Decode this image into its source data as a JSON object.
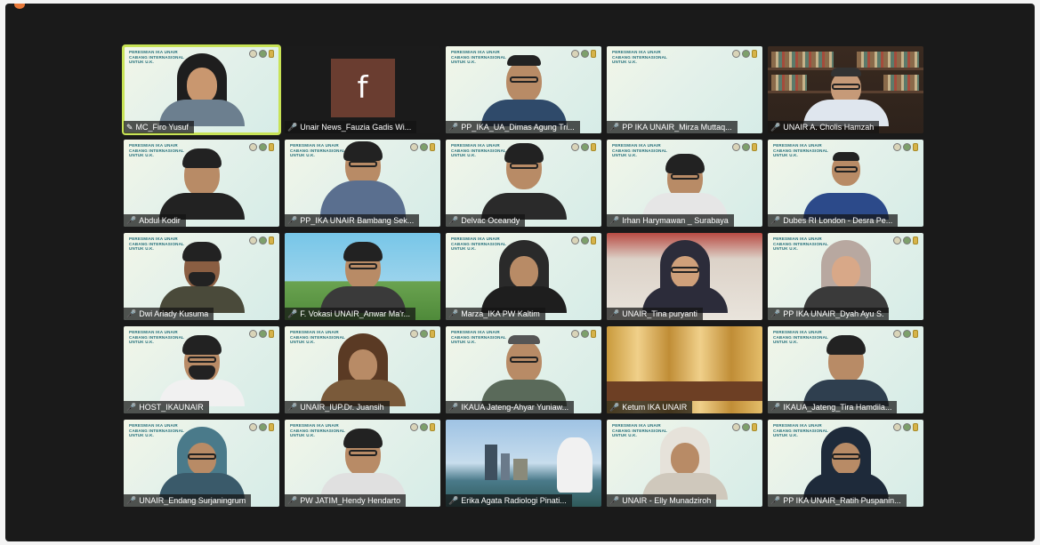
{
  "banner_lines": [
    "PERESMIAN IKA UNAIR",
    "CABANG INTERNASIONAL",
    "UNTUK U.K."
  ],
  "fb_letter": "f",
  "participants": [
    "MC_Firo Yusuf",
    "Unair News_Fauzia Gadis Wi...",
    "PP_IKA_UA_Dimas Agung Tri...",
    "PP IKA UNAIR_Mirza Muttaq...",
    "UNAIR A. Cholis Hamzah",
    "Abdul Kodir",
    "PP_IKA UNAIR Bambang Sek...",
    "Delvac Oceandy",
    "Irhan Harymawan _ Surabaya",
    "Dubes RI London - Desra Pe...",
    "Dwi Ariady Kusuma",
    "F. Vokasi UNAIR_Anwar Ma'r...",
    "Marza_IKA PW Kaltim",
    "UNAIR_Tina puryanti",
    "PP IKA UNAIR_Dyah Ayu S.",
    "HOST_IKAUNAIR",
    "UNAIR_IUP.Dr. Juansih",
    "IKAUA Jateng-Ahyar Yuniaw...",
    "Ketum IKA UNAIR",
    "IKAUA_Jateng_Tira Hamdila...",
    "UNAIR_Endang Surjaningrum",
    "PW JATIM_Hendy Hendarto",
    "Erika Agata Radiologi Pinati...",
    "UNAIR - Elly Munadziroh",
    "PP IKA UNAIR_Ratih Puspanin..."
  ]
}
